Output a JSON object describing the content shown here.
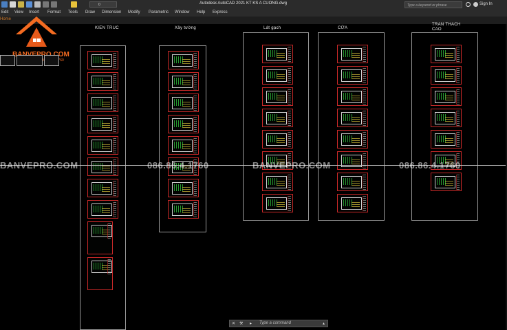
{
  "app": {
    "title": "Autodesk AutoCAD 2021   KT KS A CUONG.dwg",
    "search_placeholder": "Type a keyword or phrase",
    "sign_in": "Sign In"
  },
  "menu": [
    "Edit",
    "View",
    "Insert",
    "Format",
    "Tools",
    "Draw",
    "Dimension",
    "Modify",
    "Parametric",
    "Window",
    "Help",
    "Express"
  ],
  "quick_access": {
    "layer_value": "0"
  },
  "tab": {
    "home_label": "Home"
  },
  "logo": {
    "brand": "BANVEPRO.COM",
    "phone": "0866.86.4.1760"
  },
  "watermarks": [
    "BANVEPRO.COM",
    "086.86.4.1760",
    "BANVEPRO.COM",
    "086.86.4.1760"
  ],
  "columns": [
    {
      "label": "KIEN TRUC",
      "sheets": 10
    },
    {
      "label": "Xây tường",
      "sheets": 8
    },
    {
      "label": "Lát gạch",
      "sheets": 8
    },
    {
      "label": "CỬA",
      "sheets": 8
    },
    {
      "label": "TRAN THACH\nCAO",
      "sheets": 7
    }
  ],
  "command": {
    "placeholder": "Type a command"
  },
  "colors": {
    "accent": "#f36b21",
    "sheet_border": "#c82828",
    "frame": "#9a9a9a",
    "plan_green": "#2fbf3a"
  }
}
